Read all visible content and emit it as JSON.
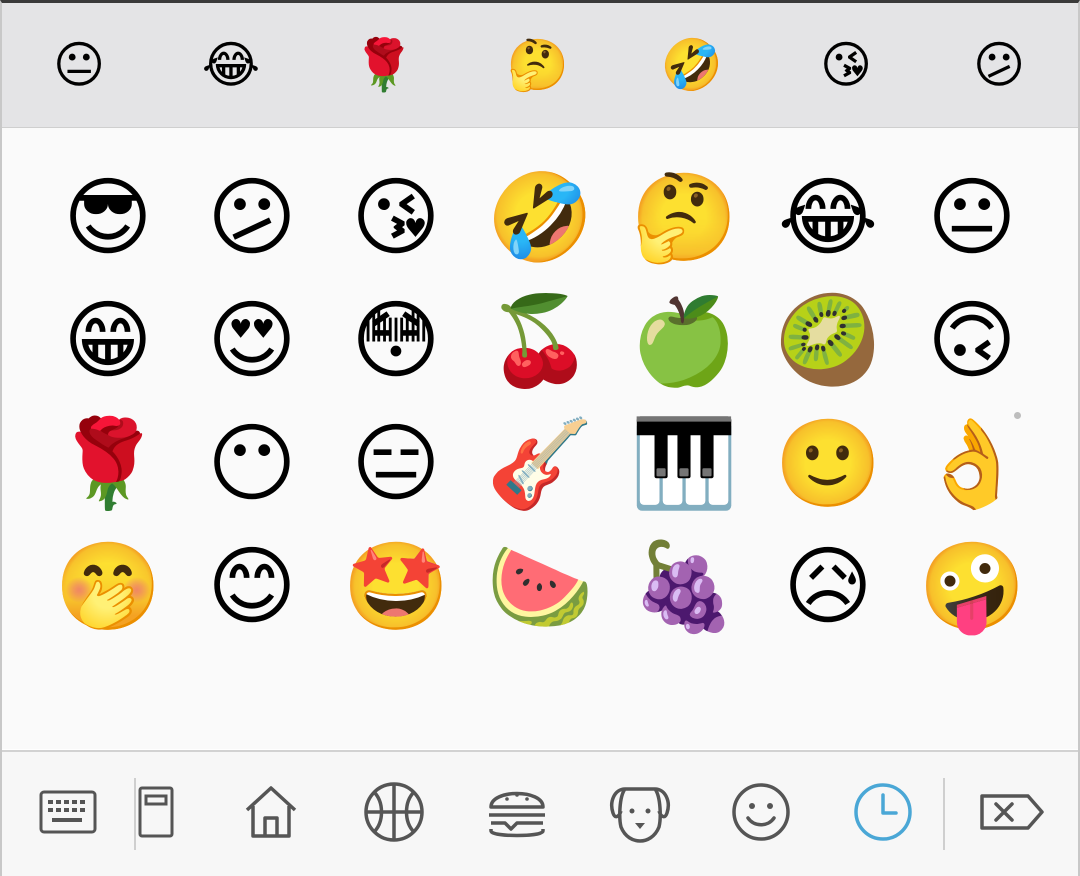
{
  "suggestions": [
    {
      "char": "😐",
      "icon": "neutral-face-icon"
    },
    {
      "char": "😂",
      "icon": "face-with-tears-of-joy-icon"
    },
    {
      "char": "🌹",
      "icon": "rose-icon"
    },
    {
      "char": "🤔",
      "icon": "thinking-face-icon"
    },
    {
      "char": "🤣",
      "icon": "rolling-on-floor-laughing-icon"
    },
    {
      "char": "😘",
      "icon": "face-blowing-kiss-icon"
    },
    {
      "char": "😕",
      "icon": "confused-face-icon"
    }
  ],
  "grid": [
    {
      "char": "😎",
      "icon": "smiling-face-with-sunglasses-icon"
    },
    {
      "char": "😕",
      "icon": "confused-face-icon"
    },
    {
      "char": "😘",
      "icon": "face-blowing-kiss-icon"
    },
    {
      "char": "🤣",
      "icon": "rolling-on-floor-laughing-icon"
    },
    {
      "char": "🤔",
      "icon": "thinking-face-icon"
    },
    {
      "char": "😂",
      "icon": "face-with-tears-of-joy-icon"
    },
    {
      "char": "😐",
      "icon": "neutral-face-icon"
    },
    {
      "char": "😁",
      "icon": "beaming-face-icon"
    },
    {
      "char": "😍",
      "icon": "heart-eyes-face-icon"
    },
    {
      "char": "😳",
      "icon": "flushed-face-icon"
    },
    {
      "char": "🍒",
      "icon": "cherries-icon"
    },
    {
      "char": "🍏",
      "icon": "green-apple-icon"
    },
    {
      "char": "🥝",
      "icon": "kiwi-fruit-icon"
    },
    {
      "char": "🙃",
      "icon": "upside-down-face-icon"
    },
    {
      "char": "🌹",
      "icon": "rose-icon"
    },
    {
      "char": "😶",
      "icon": "face-without-mouth-icon"
    },
    {
      "char": "😑",
      "icon": "expressionless-face-icon"
    },
    {
      "char": "🎸",
      "icon": "guitar-icon"
    },
    {
      "char": "🎹",
      "icon": "musical-keyboard-icon"
    },
    {
      "char": "🙂",
      "icon": "slightly-smiling-face-icon"
    },
    {
      "char": "👌",
      "icon": "ok-hand-icon"
    },
    {
      "char": "🤭",
      "icon": "face-with-hand-over-mouth-icon"
    },
    {
      "char": "😊",
      "icon": "smiling-face-with-smiling-eyes-icon"
    },
    {
      "char": "🤩",
      "icon": "star-struck-icon"
    },
    {
      "char": "🍉",
      "icon": "watermelon-icon"
    },
    {
      "char": "🍇",
      "icon": "grapes-icon"
    },
    {
      "char": "😥",
      "icon": "sad-but-relieved-face-icon"
    },
    {
      "char": "🤪",
      "icon": "zany-face-icon"
    }
  ],
  "tabs": [
    {
      "icon": "keyboard-icon",
      "selected": false
    },
    {
      "icon": "sticker-icon",
      "selected": false
    },
    {
      "icon": "home-icon",
      "selected": false
    },
    {
      "icon": "basketball-icon",
      "selected": false
    },
    {
      "icon": "burger-icon",
      "selected": false
    },
    {
      "icon": "dog-icon",
      "selected": false
    },
    {
      "icon": "smiley-icon",
      "selected": false
    },
    {
      "icon": "recent-clock-icon",
      "selected": true
    },
    {
      "icon": "backspace-icon",
      "selected": false
    }
  ],
  "colors": {
    "icon_default": "#555555",
    "icon_selected": "#4aa7d6",
    "suggest_bg": "#e4e4e6",
    "grid_bg": "#fafafa",
    "bar_bg": "#f7f7f7"
  }
}
